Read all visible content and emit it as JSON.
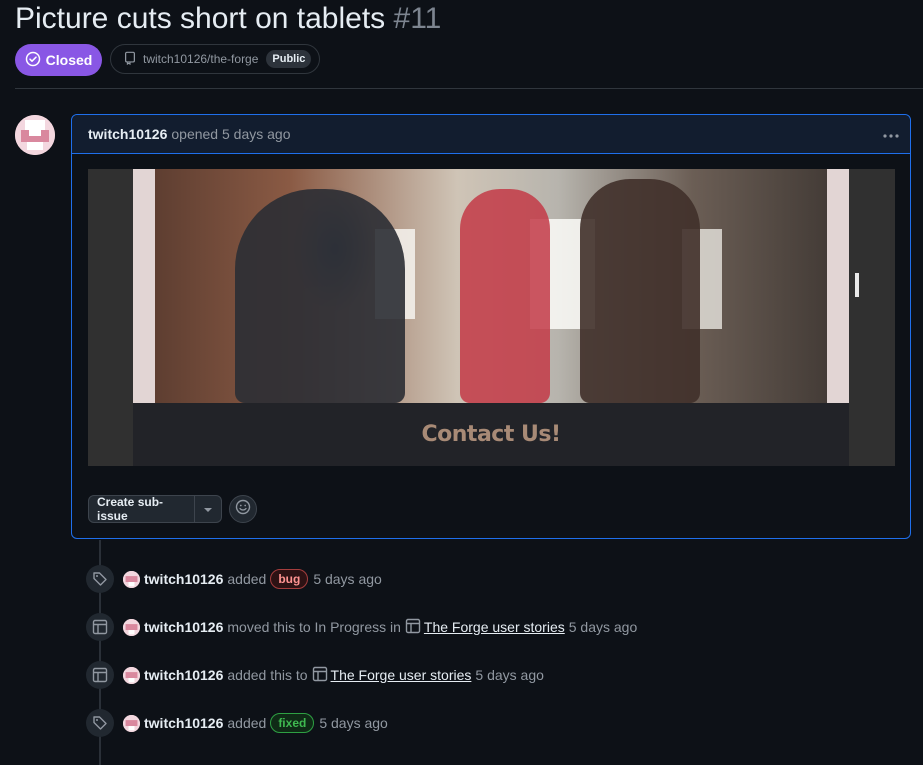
{
  "issue": {
    "title": "Picture cuts short on tablets",
    "number": "#11",
    "state": "Closed",
    "repo": "twitch10126/the-forge",
    "visibility": "Public"
  },
  "comment": {
    "author": "twitch10126",
    "action": "opened",
    "time": "5 days ago",
    "menu_icon": "kebab-horizontal-icon",
    "attachment_caption": "Contact Us!"
  },
  "actions": {
    "create_sub_issue": "Create sub-issue",
    "caret_icon": "triangle-down-icon",
    "reaction_icon": "smiley-icon"
  },
  "timeline": [
    {
      "icon": "tag-icon",
      "actor": "twitch10126",
      "verb": "added",
      "label": "bug",
      "time": "5 days ago"
    },
    {
      "icon": "table-icon",
      "actor": "twitch10126",
      "verb": "moved this to In Progress in",
      "project": "The Forge user stories",
      "time": "5 days ago"
    },
    {
      "icon": "table-icon",
      "actor": "twitch10126",
      "verb": "added this to",
      "project": "The Forge user stories",
      "time": "5 days ago"
    },
    {
      "icon": "tag-icon",
      "actor": "twitch10126",
      "verb": "added",
      "label": "fixed",
      "time": "5 days ago"
    }
  ],
  "colors": {
    "background": "#0d1117",
    "closed_badge": "#8957e5",
    "comment_border": "#1f6feb",
    "bug_label": "#ff9492",
    "fixed_label": "#3fb950"
  }
}
